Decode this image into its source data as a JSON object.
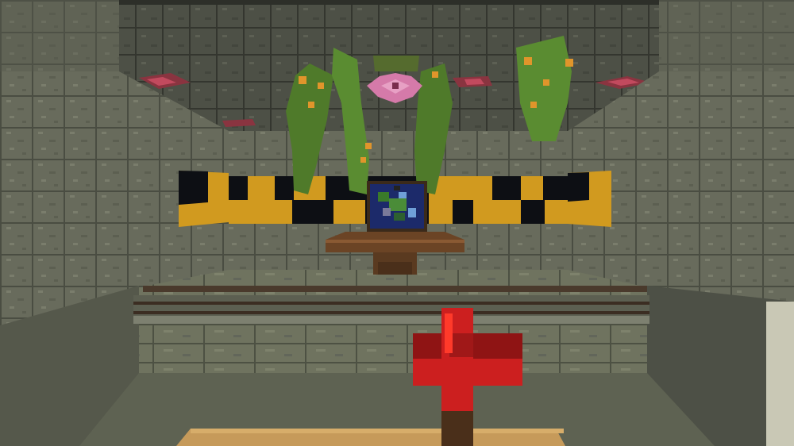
{
  "game": "Minecraft",
  "view": "first-person",
  "scene": {
    "room_material": "stone-brick",
    "wall_stripe": {
      "pattern": "yellow-black-hazard",
      "colors": [
        "#d19a1f",
        "#0d0f14"
      ]
    },
    "ceiling_features": [
      "spore-blossom",
      "glow-berry-vines",
      "pink-petal-patches"
    ],
    "floor_features": [
      "rail-track",
      "wooden-shelf"
    ],
    "wall_item": "map-in-item-frame"
  },
  "hotbar": {
    "held_item": "redstone-torch",
    "held_item_icon": "redstone-torch-icon"
  },
  "colors": {
    "stone": "#6b6e5f",
    "stone_dark": "#3c3f36",
    "leaf": "#4f7a2a",
    "berry": "#e0952b",
    "wood": "#6b4425",
    "arm": "#c69a5a",
    "redstone": "#cc1f1f"
  }
}
